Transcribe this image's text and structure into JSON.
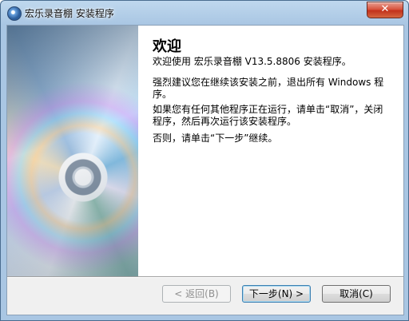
{
  "window": {
    "title": "宏乐录音棚 安装程序",
    "close_symbol": "✕"
  },
  "content": {
    "heading": "欢迎",
    "paragraphs": [
      "欢迎使用 宏乐录音棚 V13.5.8806 安装程序。",
      "强烈建议您在继续该安装之前，退出所有 Windows 程序。",
      "如果您有任何其他程序正在运行，请单击“取消”，关闭程序，然后再次运行该安装程序。",
      "否则，请单击“下一步”继续。"
    ]
  },
  "buttons": {
    "back": "< 返回(B)",
    "next": "下一步(N) >",
    "cancel": "取消(C)"
  },
  "icons": {
    "app": "installer-app-icon",
    "close": "close-icon"
  }
}
